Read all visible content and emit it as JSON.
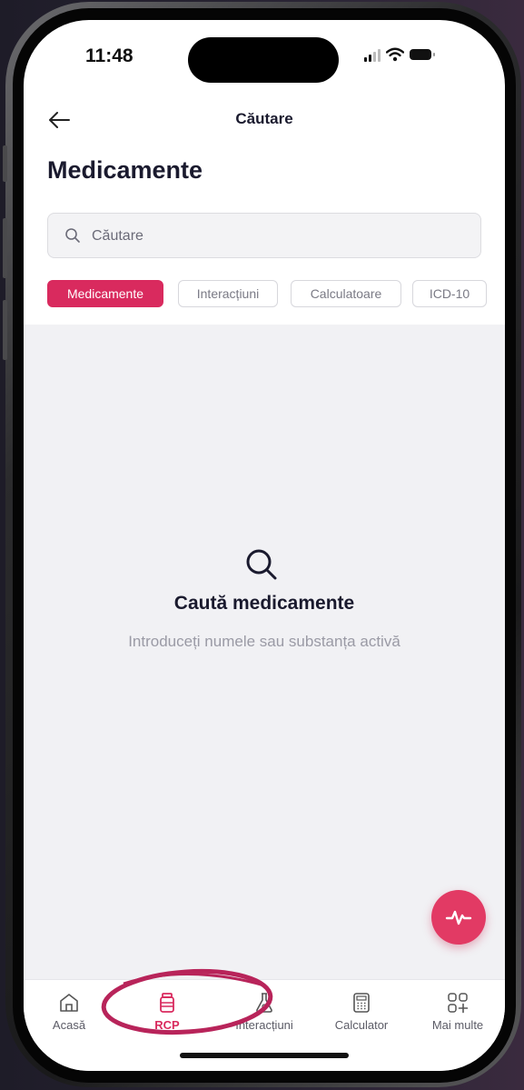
{
  "status_bar": {
    "time": "11:48"
  },
  "header": {
    "title": "Căutare"
  },
  "page": {
    "title": "Medicamente"
  },
  "search": {
    "placeholder": "Căutare"
  },
  "filters": [
    {
      "label": "Medicamente",
      "active": true
    },
    {
      "label": "Interacțiuni",
      "active": false
    },
    {
      "label": "Calculatoare",
      "active": false
    },
    {
      "label": "ICD-10",
      "active": false
    }
  ],
  "empty_state": {
    "title": "Caută medicamente",
    "subtitle": "Introduceți numele sau substanța activă"
  },
  "tabbar": {
    "items": [
      {
        "label": "Acasă",
        "icon": "home-icon",
        "active": false
      },
      {
        "label": "RCP",
        "icon": "medicine-bottle-icon",
        "active": true
      },
      {
        "label": "Interacțiuni",
        "icon": "flask-icon",
        "active": false
      },
      {
        "label": "Calculator",
        "icon": "calculator-icon",
        "active": false
      },
      {
        "label": "Mai multe",
        "icon": "grid-plus-icon",
        "active": false
      }
    ]
  },
  "colors": {
    "accent": "#d92a5e",
    "fab": "#e23a64",
    "background": "#f1f1f4",
    "text_dark": "#1a1a2e",
    "text_muted": "#9a9aa5"
  }
}
